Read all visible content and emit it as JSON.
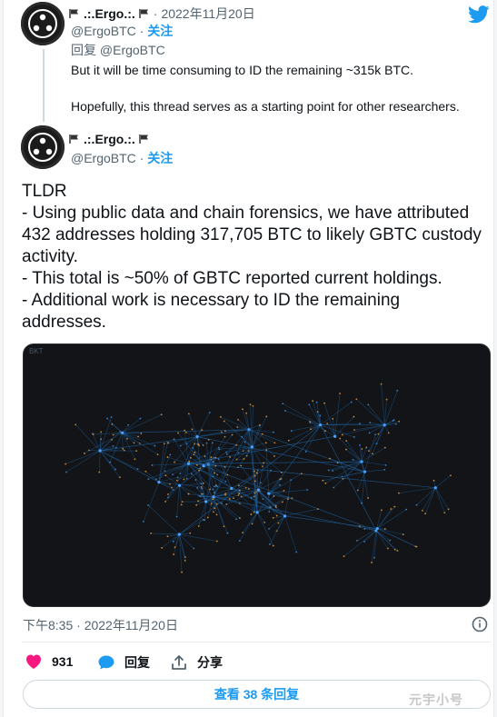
{
  "top_tweet": {
    "display_name": ".:.Ergo.:.",
    "date": "2022年11月20日",
    "handle": "@ErgoBTC",
    "follow_label": "关注",
    "reply_to_label": "回复",
    "reply_to_handle": "@ErgoBTC",
    "text_line1": "But it will be time consuming to ID the remaining ~315k BTC.",
    "text_line2": "Hopefully, this thread serves as a starting point for other researchers."
  },
  "main_tweet": {
    "display_name": ".:.Ergo.:.",
    "handle": "@ErgoBTC",
    "follow_label": "关注",
    "text": "TLDR\n- Using public data and chain forensics, we have attributed 432 addresses holding 317,705 BTC to likely GBTC custody activity.\n- This total is ~50% of GBTC reported current holdings.\n- Additional work is necessary to ID the remaining addresses.",
    "media_label": "BKT",
    "timestamp": "下午8:35 · 2022年11月20日",
    "likes": "931",
    "reply_label": "回复",
    "share_label": "分享",
    "view_replies_label": "查看 38 条回复"
  },
  "watermark": "元宇小号",
  "colors": {
    "accent": "#1d9bf0",
    "like": "#f91880",
    "media_bg": "#121417",
    "graph_edge": "#1e5b94",
    "graph_node_orange": "#c98a3a"
  },
  "icons": [
    "twitter-logo-icon",
    "flag-icon",
    "heart-icon",
    "reply-bubble-icon",
    "share-icon",
    "info-icon"
  ]
}
